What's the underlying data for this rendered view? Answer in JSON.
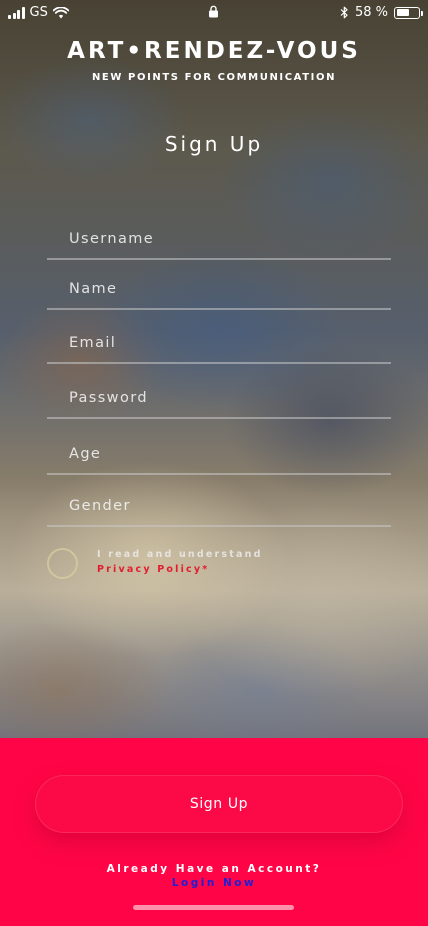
{
  "status_bar": {
    "carrier": "GS",
    "battery_text": "58 %",
    "battery_level": 0.58,
    "icons": [
      "signal-icon",
      "wifi-icon",
      "lock-icon",
      "bluetooth-icon",
      "battery-icon"
    ]
  },
  "brand": {
    "title": "ART•RENDEZ-VOUS",
    "subtitle": "NEW POINTS FOR COMMUNICATION"
  },
  "page": {
    "title": "Sign Up"
  },
  "form": {
    "fields": [
      {
        "placeholder": "Username",
        "value": ""
      },
      {
        "placeholder": "Name",
        "value": ""
      },
      {
        "placeholder": "Email",
        "value": ""
      },
      {
        "placeholder": "Password",
        "value": ""
      },
      {
        "placeholder": "Age",
        "value": ""
      },
      {
        "placeholder": "Gender",
        "value": ""
      }
    ],
    "policy": {
      "text": "I read and understand",
      "link": "Privacy Policy*",
      "checked": false
    }
  },
  "actions": {
    "signup_label": "Sign Up",
    "already_text": "Already Have an Account?",
    "login_label": "Login Now"
  },
  "colors": {
    "accent": "#ff0547",
    "link_red": "#e01e2e",
    "link_blue": "#1f1fd6",
    "text": "#ffffff"
  }
}
